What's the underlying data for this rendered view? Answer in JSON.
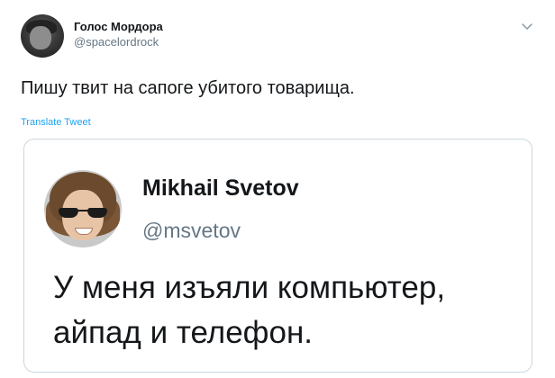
{
  "tweet": {
    "author_name": "Голос Мордора",
    "author_handle": "@spacelordrock",
    "text": "Пишу твит на сапоге убитого товарища.",
    "translate_label": "Translate Tweet",
    "menu_icon": "chevron-down-icon"
  },
  "quote": {
    "author_name": "Mikhail Svetov",
    "author_handle": "@msvetov",
    "text_lines": [
      "У меня изъяли компьютер,",
      "айпад и телефон."
    ]
  },
  "colors": {
    "link": "#1da1f2",
    "secondary_text": "#657786",
    "border": "#ccd6dd"
  }
}
